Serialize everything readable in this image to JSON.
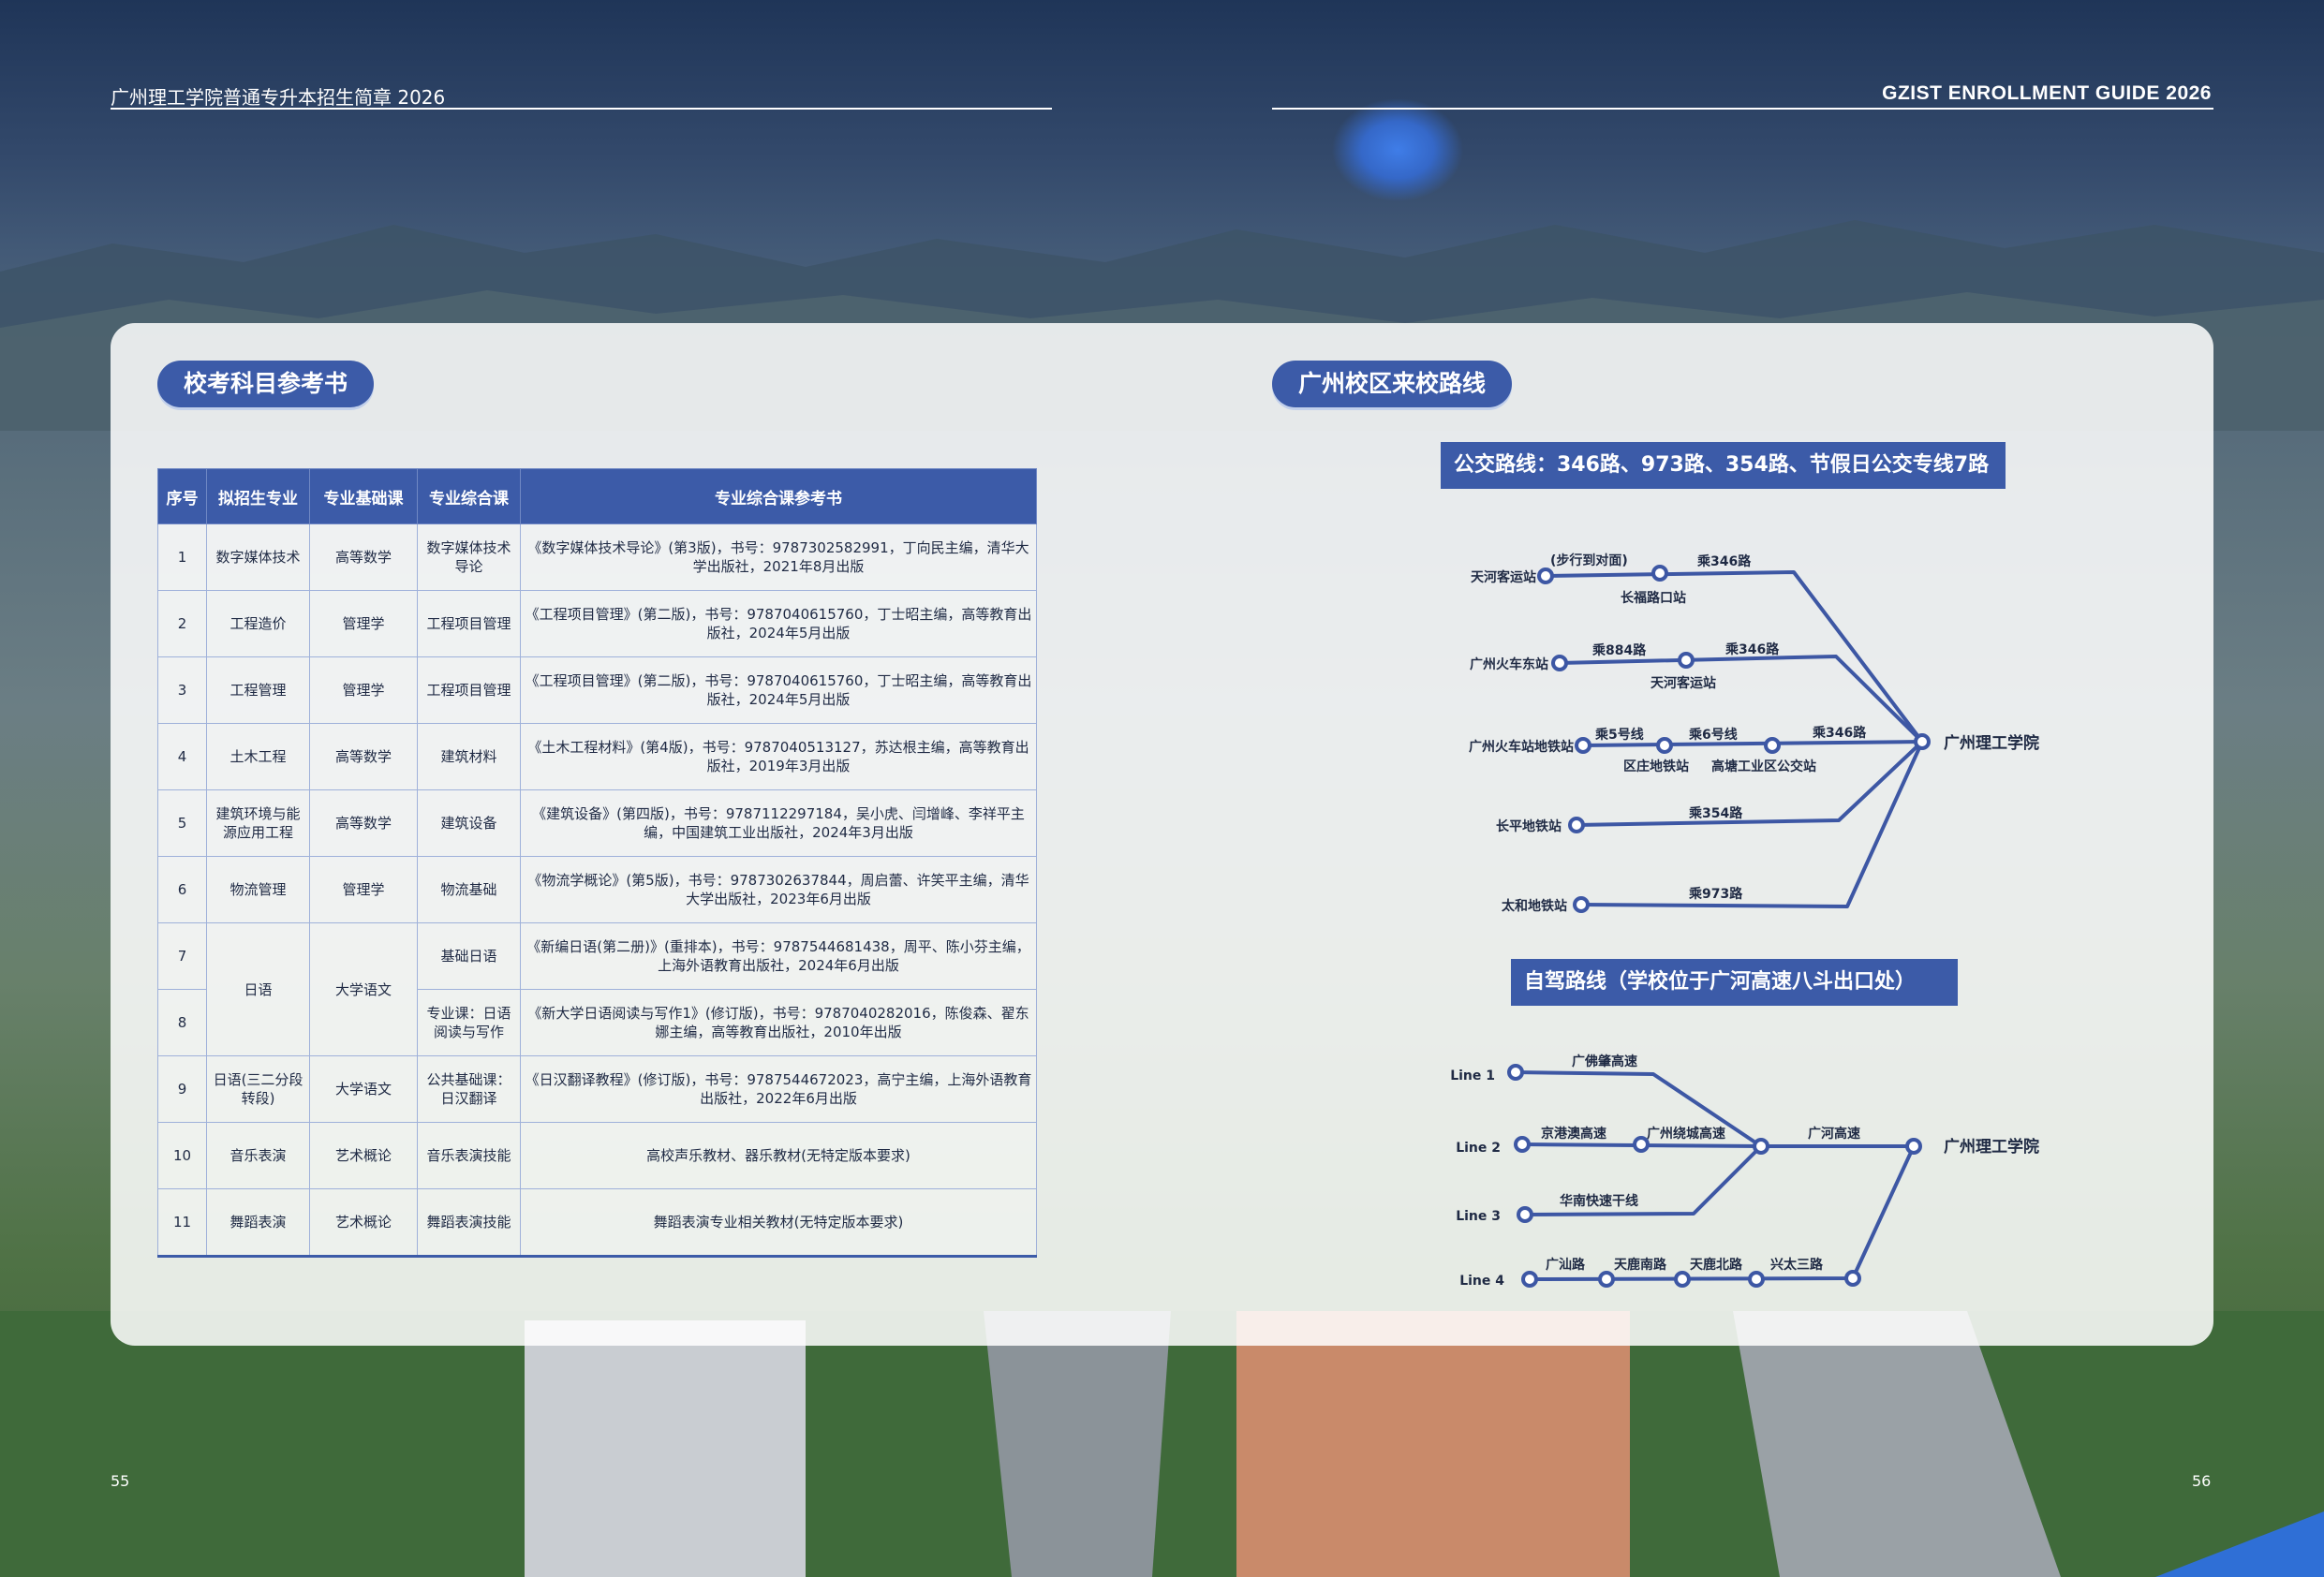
{
  "header": {
    "left_title": "广州理工学院普通专升本招生简章 2026",
    "right_title": "GZIST ENROLLMENT GUIDE 2026"
  },
  "pages": {
    "left": "55",
    "right": "56"
  },
  "left": {
    "section_title": "校考科目参考书",
    "table": {
      "headers": [
        "序号",
        "拟招生专业",
        "专业基础课",
        "专业综合课",
        "专业综合课参考书"
      ],
      "rows": [
        {
          "no": "1",
          "major": "数字媒体技术",
          "base": "高等数学",
          "comp": "数字媒体技术导论",
          "ref": "《数字媒体技术导论》(第3版)，书号：9787302582991，丁向民主编，清华大学出版社，2021年8月出版"
        },
        {
          "no": "2",
          "major": "工程造价",
          "base": "管理学",
          "comp": "工程项目管理",
          "ref": "《工程项目管理》(第二版)，书号：9787040615760，丁士昭主编，高等教育出版社，2024年5月出版"
        },
        {
          "no": "3",
          "major": "工程管理",
          "base": "管理学",
          "comp": "工程项目管理",
          "ref": "《工程项目管理》(第二版)，书号：9787040615760，丁士昭主编，高等教育出版社，2024年5月出版"
        },
        {
          "no": "4",
          "major": "土木工程",
          "base": "高等数学",
          "comp": "建筑材料",
          "ref": "《土木工程材料》(第4版)，书号：9787040513127，苏达根主编，高等教育出版社，2019年3月出版"
        },
        {
          "no": "5",
          "major": "建筑环境与能源应用工程",
          "base": "高等数学",
          "comp": "建筑设备",
          "ref": "《建筑设备》(第四版)，书号：9787112297184，吴小虎、闫增峰、李祥平主编，中国建筑工业出版社，2024年3月出版"
        },
        {
          "no": "6",
          "major": "物流管理",
          "base": "管理学",
          "comp": "物流基础",
          "ref": "《物流学概论》(第5版)，书号：9787302637844，周启蕾、许笑平主编，清华大学出版社，2023年6月出版"
        }
      ],
      "japanese": {
        "major": "日语",
        "base": "大学语文",
        "rows": [
          {
            "no": "7",
            "comp": "基础日语",
            "ref": "《新编日语(第二册)》(重排本)，书号：9787544681438，周平、陈小芬主编，上海外语教育出版社，2024年6月出版"
          },
          {
            "no": "8",
            "comp": "专业课：日语阅读与写作",
            "ref": "《新大学日语阅读与写作1》(修订版)，书号：9787040282016，陈俊森、翟东娜主编，高等教育出版社，2010年出版"
          }
        ]
      },
      "rows_tail": [
        {
          "no": "9",
          "major": "日语(三二分段转段)",
          "base": "大学语文",
          "comp": "公共基础课：日汉翻译",
          "ref": "《日汉翻译教程》(修订版)，书号：9787544672023，高宁主编，上海外语教育出版社，2022年6月出版"
        },
        {
          "no": "10",
          "major": "音乐表演",
          "base": "艺术概论",
          "comp": "音乐表演技能",
          "ref": "高校声乐教材、器乐教材(无特定版本要求)"
        },
        {
          "no": "11",
          "major": "舞蹈表演",
          "base": "艺术概论",
          "comp": "舞蹈表演技能",
          "ref": "舞蹈表演专业相关教材(无特定版本要求)"
        }
      ]
    }
  },
  "right": {
    "section_title": "广州校区来校路线",
    "bus_title": "公交路线：346路、973路、354路、节假日公交专线7路",
    "drive_title": "自驾路线（学校位于广河高速八斗出口处）",
    "bus": {
      "destination": "广州理工学院",
      "labels": {
        "r1_start": "天河客运站",
        "r1_top": "(步行到对面)",
        "r1_bus": "乘346路",
        "r1_stop": "长福路口站",
        "r2_start": "广州火车东站",
        "r2_bus1": "乘884路",
        "r2_bus2": "乘346路",
        "r2_stop": "天河客运站",
        "r3_start": "广州火车站地铁站",
        "r3_m1": "乘5号线",
        "r3_m2": "乘6号线",
        "r3_bus": "乘346路",
        "r3_stop1": "区庄地铁站",
        "r3_stop2": "高塘工业区公交站",
        "r4_start": "长平地铁站",
        "r4_bus": "乘354路",
        "r5_start": "太和地铁站",
        "r5_bus": "乘973路"
      }
    },
    "drive": {
      "destination": "广州理工学院",
      "labels": {
        "l1": "Line 1",
        "l1_road": "广佛肇高速",
        "l2": "Line 2",
        "l2_road1": "京港澳高速",
        "l2_road2": "广州绕城高速",
        "l3": "Line 3",
        "l3_road": "华南快速干线",
        "l4": "Line 4",
        "l4_road1": "广汕路",
        "l4_road2": "天鹿南路",
        "l4_road3": "天鹿北路",
        "l4_road4": "兴太三路",
        "main": "广河高速"
      }
    }
  }
}
